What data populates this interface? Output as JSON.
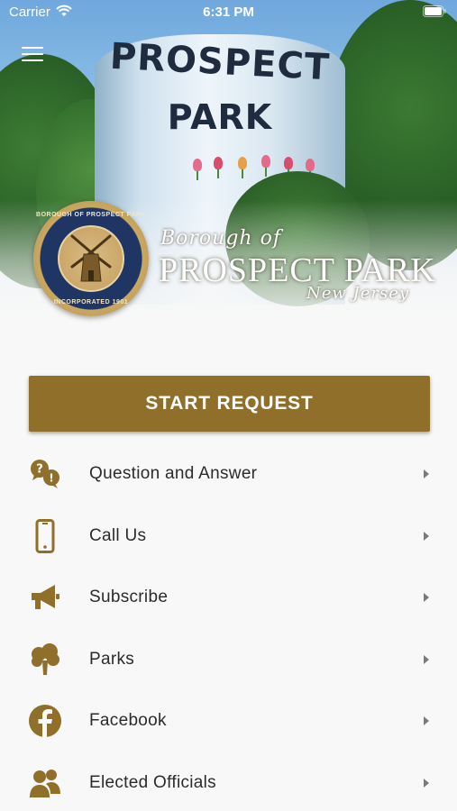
{
  "status_bar": {
    "carrier": "Carrier",
    "time": "6:31 PM"
  },
  "hero": {
    "tower_line1": "PROSPECT",
    "tower_line2": "PARK",
    "borough_line": "Borough of",
    "prospect_line": "PROSPECT PARK",
    "state_line": "New Jersey",
    "seal": {
      "top_text": "BOROUGH OF PROSPECT PARK",
      "bottom_text": "INCORPORATED 1901"
    }
  },
  "start_request": {
    "label": "START REQUEST"
  },
  "menu": [
    {
      "label": "Question and Answer",
      "icon": "question-answer-icon"
    },
    {
      "label": "Call Us",
      "icon": "phone-icon"
    },
    {
      "label": "Subscribe",
      "icon": "megaphone-icon"
    },
    {
      "label": "Parks",
      "icon": "tree-icon"
    },
    {
      "label": "Facebook",
      "icon": "facebook-icon"
    },
    {
      "label": "Elected Officials",
      "icon": "people-icon"
    }
  ],
  "colors": {
    "accent": "#8f6f2a",
    "icon": "#8f6f2a",
    "text": "#2b2b2b",
    "chevron": "#7a7a7a",
    "background": "#f8f8f8"
  }
}
